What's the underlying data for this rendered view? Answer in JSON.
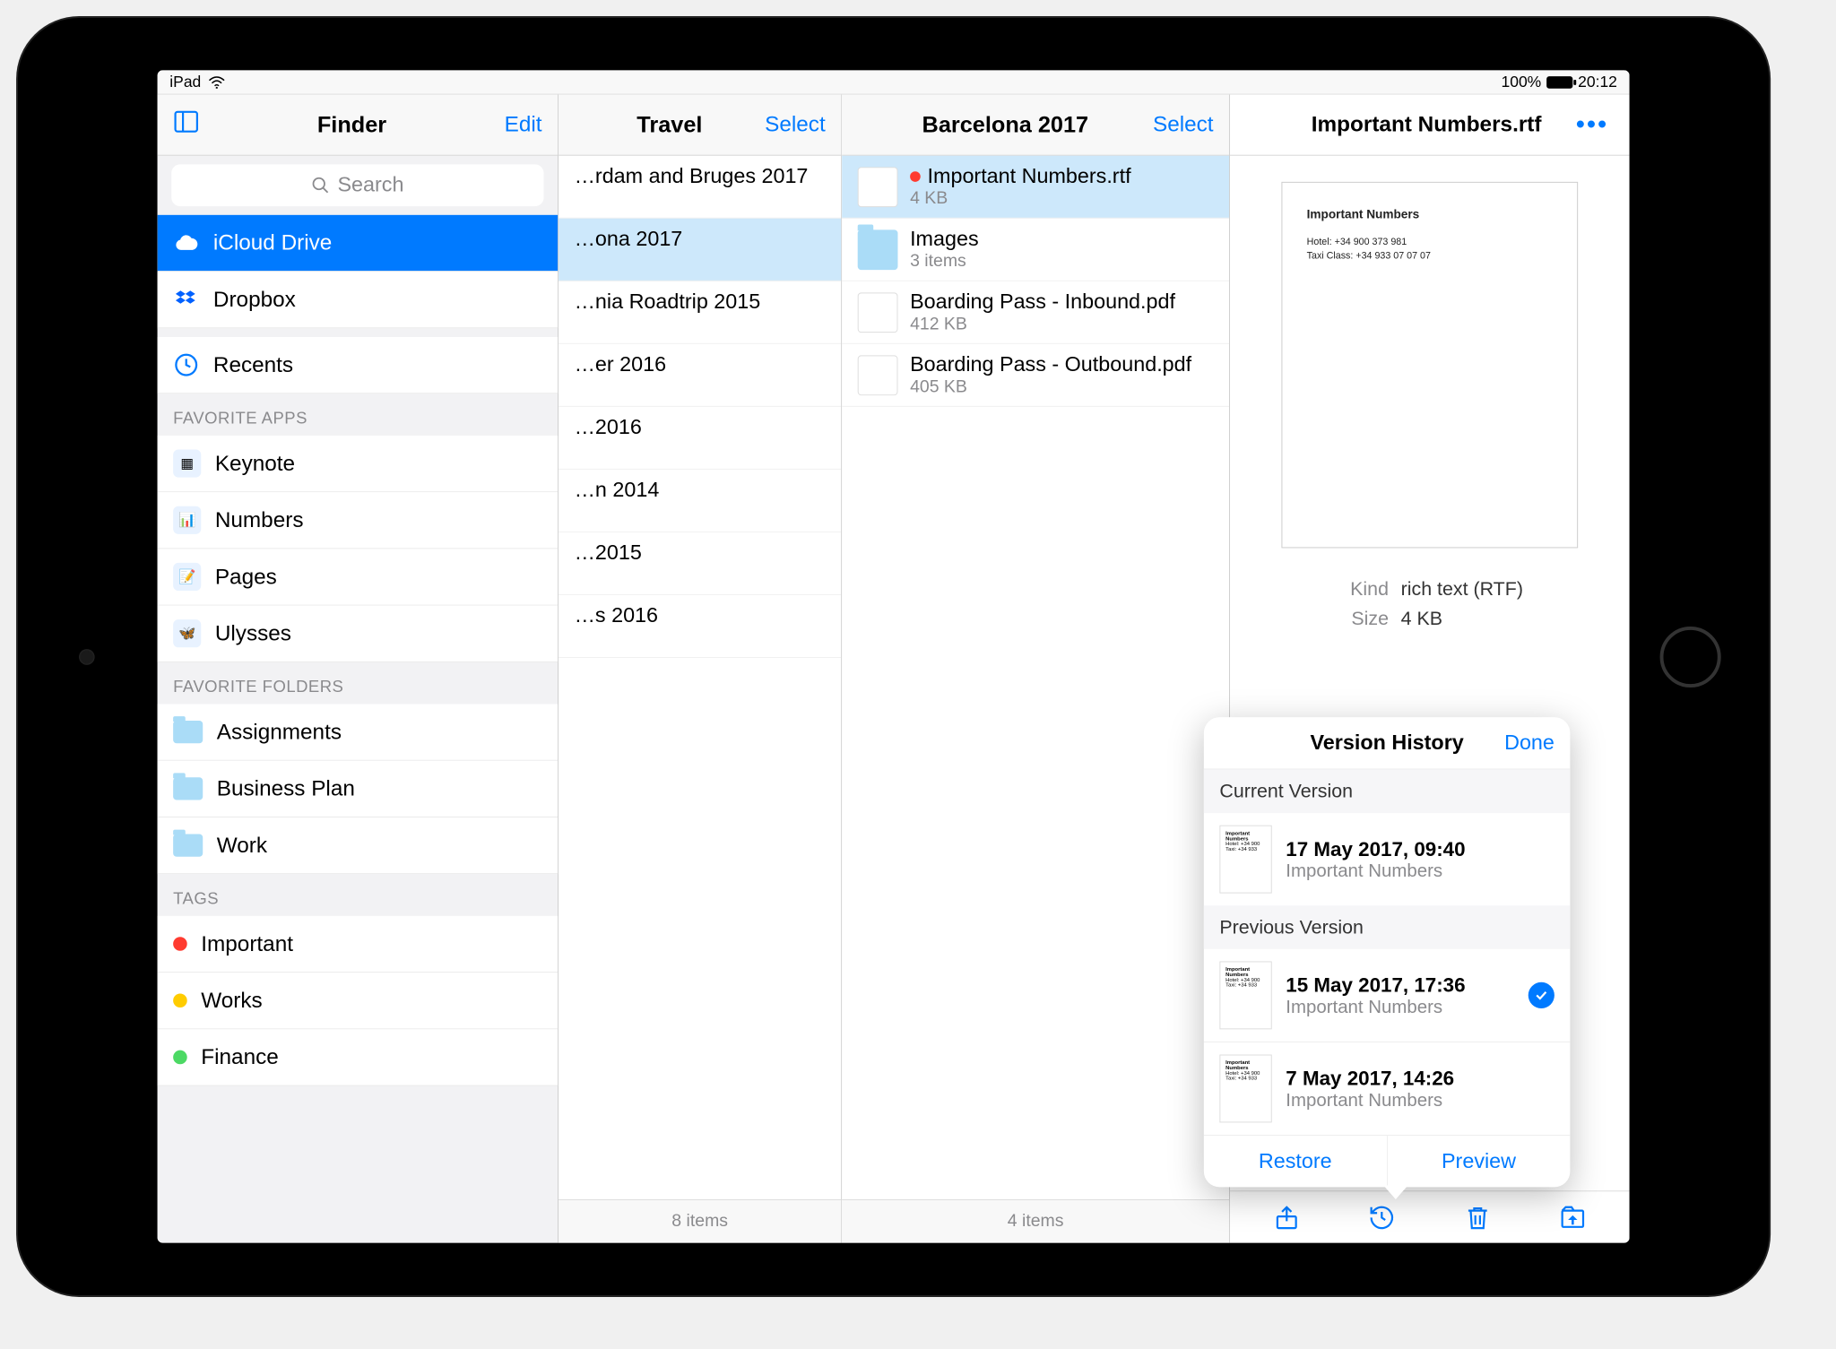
{
  "status": {
    "device": "iPad",
    "battery": "100%",
    "time": "20:12"
  },
  "sidebar": {
    "title": "Finder",
    "edit": "Edit",
    "search_placeholder": "Search",
    "locations": [
      {
        "label": "iCloud Drive",
        "icon": "cloud",
        "active": true
      },
      {
        "label": "Dropbox",
        "icon": "dropbox"
      }
    ],
    "recents": {
      "label": "Recents"
    },
    "fav_apps_header": "FAVORITE APPS",
    "fav_apps": [
      {
        "label": "Keynote",
        "glyph": "▦"
      },
      {
        "label": "Numbers",
        "glyph": "📊"
      },
      {
        "label": "Pages",
        "glyph": "📝"
      },
      {
        "label": "Ulysses",
        "glyph": "🦋"
      }
    ],
    "fav_folders_header": "FAVORITE FOLDERS",
    "fav_folders": [
      {
        "label": "Assignments"
      },
      {
        "label": "Business Plan"
      },
      {
        "label": "Work"
      }
    ],
    "tags_header": "TAGS",
    "tags": [
      {
        "label": "Important",
        "color": "#ff3b30"
      },
      {
        "label": "Works",
        "color": "#ffcc00"
      },
      {
        "label": "Finance",
        "color": "#4cd964"
      }
    ]
  },
  "col_travel": {
    "title": "Travel",
    "select": "Select",
    "items": [
      {
        "name": "…rdam and Bruges 2017"
      },
      {
        "name": "…ona 2017",
        "selected": true
      },
      {
        "name": "…nia Roadtrip 2015"
      },
      {
        "name": "…er 2016"
      },
      {
        "name": "…2016"
      },
      {
        "name": "…n 2014"
      },
      {
        "name": "…2015"
      },
      {
        "name": "…s 2016"
      }
    ],
    "footer": "8 items"
  },
  "col_barcelona": {
    "title": "Barcelona 2017",
    "select": "Select",
    "items": [
      {
        "name": "Important Numbers.rtf",
        "meta": "4 KB",
        "tagged": true,
        "selected": true,
        "thumb": "doc"
      },
      {
        "name": "Images",
        "meta": "3 items",
        "thumb": "folder"
      },
      {
        "name": "Boarding Pass - Inbound.pdf",
        "meta": "412 KB",
        "thumb": "doc"
      },
      {
        "name": "Boarding Pass - Outbound.pdf",
        "meta": "405 KB",
        "thumb": "doc"
      }
    ],
    "footer": "4 items"
  },
  "detail": {
    "title": "Important Numbers.rtf",
    "preview": {
      "title": "Important Numbers",
      "lines": [
        "Hotel: +34 900 373 981",
        "Taxi Class: +34 933 07 07 07"
      ]
    },
    "meta": [
      {
        "k": "Kind",
        "v": "rich text (RTF)"
      },
      {
        "k": "Size",
        "v": "4 KB"
      }
    ]
  },
  "popover": {
    "title": "Version History",
    "done": "Done",
    "section_current": "Current Version",
    "section_prev": "Previous Version",
    "current": {
      "date": "17 May 2017, 09:40",
      "name": "Important Numbers"
    },
    "previous": [
      {
        "date": "15 May 2017, 17:36",
        "name": "Important Numbers",
        "checked": true
      },
      {
        "date": "7 May 2017, 14:26",
        "name": "Important Numbers"
      }
    ],
    "restore": "Restore",
    "preview": "Preview"
  }
}
